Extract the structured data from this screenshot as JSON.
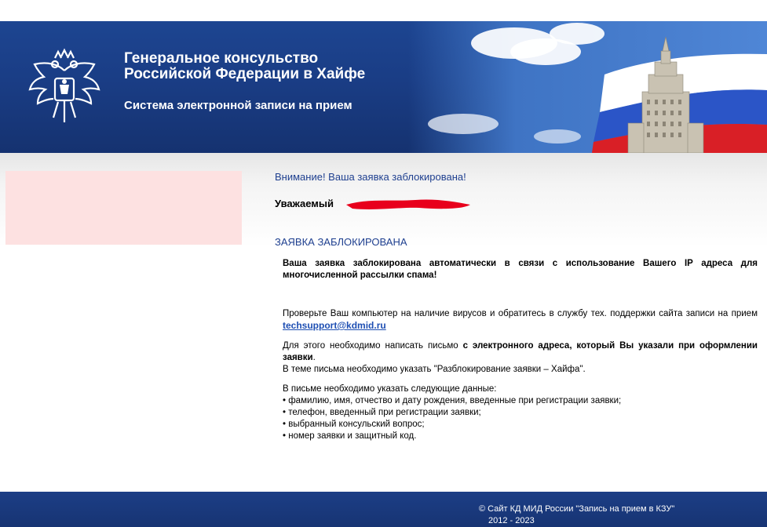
{
  "header": {
    "title_line1": "Генеральное консульство",
    "title_line2": "Российской Федерации в Хайфе",
    "subtitle": "Система электронной записи на прием"
  },
  "main": {
    "alert_title": "Внимание! Ваша заявка заблокирована!",
    "greeting": "Уважаемый",
    "section_title": "ЗАЯВКА ЗАБЛОКИРОВАНА",
    "para_blocked": "Ваша заявка заблокирована автоматически в связи с использование Вашего IP адреса для многочисленной рассылки спама!",
    "para_check_text": "Проверьте Ваш компьютер на наличие вирусов и обратитесь в службу тех. поддержки сайта записи на прием",
    "support_email": "techsupport@kdmid.ru",
    "para_write_1": "Для этого необходимо написать письмо",
    "para_write_bold": "с электронного адреса, который Вы указали при оформлении заявки",
    "para_write_dot": ".",
    "para_write_2": "В теме письма необходимо указать \"Разблокирование заявки – Хайфа\".",
    "data_intro": "В письме необходимо указать следующие данные:",
    "data_items": [
      "• фамилию, имя, отчество и дату рождения, введенные при регистрации заявки;",
      "• телефон, введенный при регистрации заявки;",
      "• выбранный консульский вопрос;",
      "• номер заявки и защитный код."
    ]
  },
  "footer": {
    "line1": "© Сайт КД МИД России \"Запись на прием в КЗУ\"",
    "line2": "2012 - 2023"
  },
  "colors": {
    "header_blue": "#1a3d85",
    "accent_blue": "#1e3f8f",
    "link_blue": "#1e4fb3",
    "left_panel_pink": "#fde1e1",
    "redaction_red": "#e8001c"
  },
  "icons": {
    "coat_of_arms": "double-headed-eagle-icon",
    "flag": "russian-flag-with-building"
  }
}
